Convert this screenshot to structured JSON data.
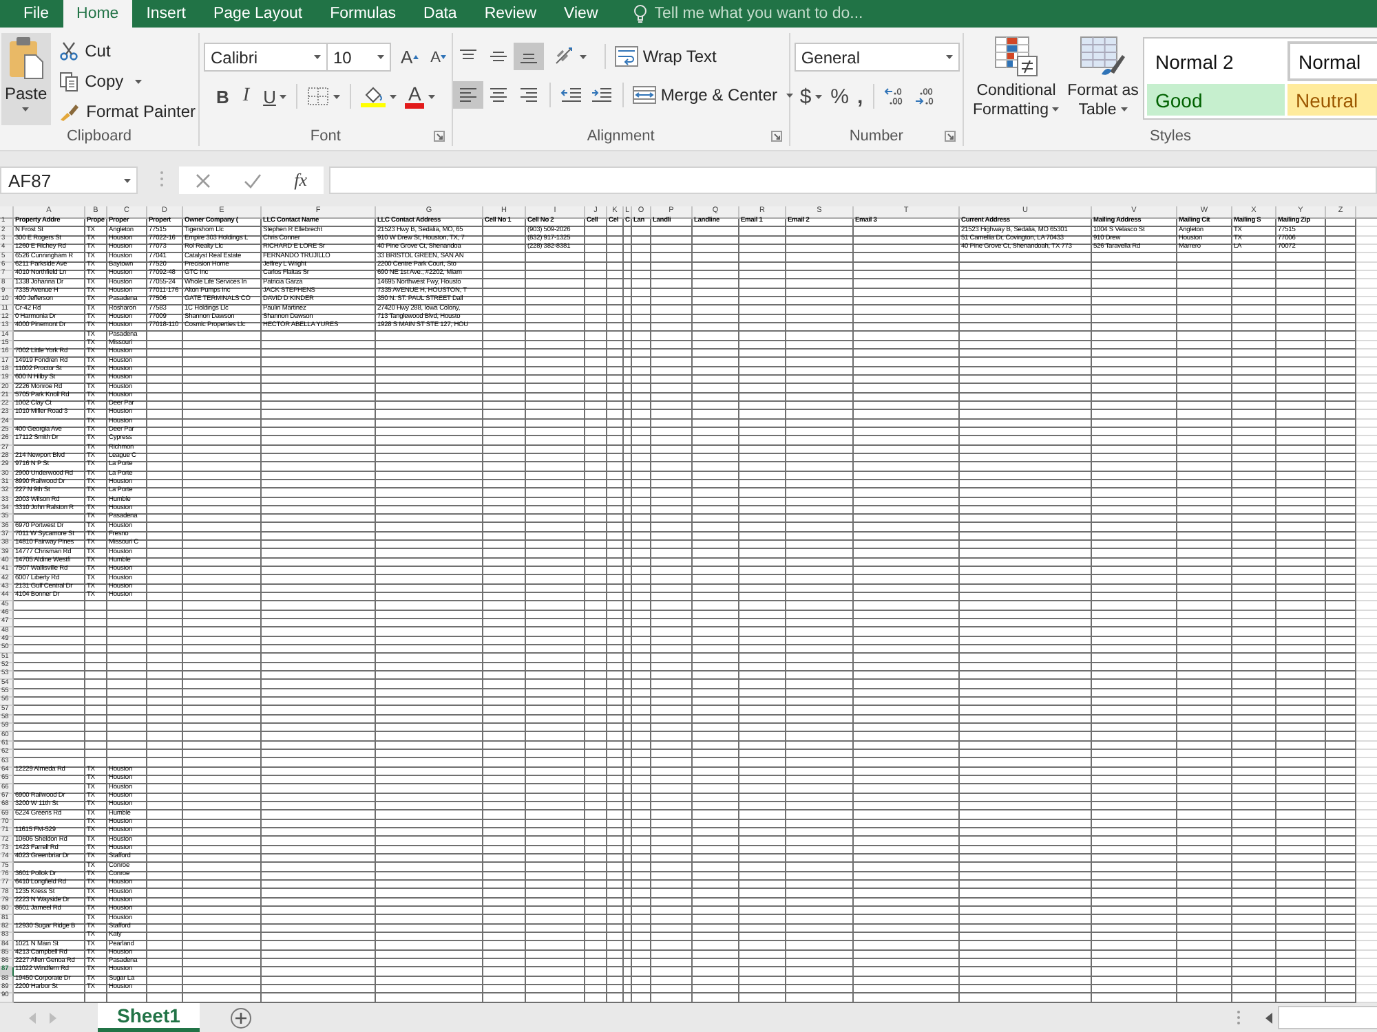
{
  "ribbon_tabs": [
    {
      "label": "File",
      "selected": false
    },
    {
      "label": "Home",
      "selected": true
    },
    {
      "label": "Insert",
      "selected": false
    },
    {
      "label": "Page Layout",
      "selected": false
    },
    {
      "label": "Formulas",
      "selected": false
    },
    {
      "label": "Data",
      "selected": false
    },
    {
      "label": "Review",
      "selected": false
    },
    {
      "label": "View",
      "selected": false
    }
  ],
  "tell_me": {
    "placeholder": "Tell me what you want to do..."
  },
  "clipboard": {
    "label": "Clipboard",
    "paste": "Paste",
    "cut": "Cut",
    "copy": "Copy",
    "format_painter": "Format Painter"
  },
  "font": {
    "label": "Font",
    "name": "Calibri",
    "size": "10",
    "grow": "A",
    "shrink": "A",
    "bold": "B",
    "italic": "I",
    "underline": "U",
    "font_color": "A"
  },
  "alignment": {
    "label": "Alignment",
    "vertical": [
      {
        "selected": false
      },
      {
        "selected": false
      },
      {
        "selected": true
      }
    ],
    "horizontal": [
      {
        "selected": true
      },
      {
        "selected": false
      },
      {
        "selected": false
      }
    ],
    "wrap_text": "Wrap Text",
    "merge_center": "Merge & Center"
  },
  "number": {
    "label": "Number",
    "format": "General",
    "currency": "$",
    "percent": "%",
    "comma": ","
  },
  "styles": {
    "label": "Styles",
    "conditional_formatting": "Conditional Formatting",
    "format_as_table": "Format as Table",
    "gallery": [
      {
        "label": "Normal 2",
        "kind": "plain"
      },
      {
        "label": "Normal",
        "kind": "normal"
      },
      {
        "label": "Good",
        "kind": "good"
      },
      {
        "label": "Neutral",
        "kind": "neutral"
      }
    ]
  },
  "formula_bar": {
    "name_box": "AF87",
    "function_label": "fx"
  },
  "sheet": {
    "columns": [
      "A",
      "B",
      "C",
      "D",
      "E",
      "F",
      "G",
      "H",
      "I",
      "J",
      "K",
      "L",
      "O",
      "P",
      "Q",
      "R",
      "S",
      "T",
      "U",
      "V",
      "W",
      "X",
      "Y",
      "Z"
    ],
    "rows": [
      {
        "number": "1",
        "selected": false,
        "cells": [
          "Property Addre",
          "Prope",
          "Proper",
          "Propert",
          "Owner Company (",
          "LLC Contact Name",
          "LLC Contact Address",
          "Cell No 1",
          "Cell No 2",
          "Cell",
          "Cel",
          "C",
          "Lan",
          "Landli",
          "Landline",
          "Email 1",
          "Email 2",
          "Email 3",
          "Current Address",
          "Mailing Address",
          "Mailing Cit",
          "Mailing S",
          "Mailing Zip",
          null
        ]
      },
      {
        "number": "2",
        "selected": false,
        "cells": [
          "N Frost St",
          "TX",
          "Angleton",
          "77515",
          "Tigershom Llc",
          "Stephen R Ellebrecht",
          "21523 Hwy B, Sedalia, MO, 65",
          null,
          "(903) 509-2026",
          null,
          null,
          null,
          null,
          null,
          null,
          null,
          null,
          null,
          "21523 Highway B, Sedalia, MO 65301",
          "1004 S Velasco St",
          "Angleton",
          "TX",
          "77515",
          null
        ]
      },
      {
        "number": "3",
        "selected": false,
        "cells": [
          "300 E Rogers St",
          "TX",
          "Houston",
          "77022-16",
          "Empire 303 Holdings L",
          "Chris Conner",
          "910 W Drew St, Houston, TX, 7",
          null,
          "(832) 917-1325",
          null,
          null,
          null,
          null,
          null,
          null,
          null,
          null,
          null,
          "51 Camellia Dr, Covington, LA 70433",
          "910 Drew",
          "Houston",
          "TX",
          "77006",
          null
        ]
      },
      {
        "number": "4",
        "selected": false,
        "cells": [
          "1260 E Richey Rd",
          "TX",
          "Houston",
          "77073",
          "Rol Realty Llc",
          "RICHARD E LORE Sr",
          "40 Pine Grove Ct, Shenandoa",
          null,
          "(228) 382-8381",
          null,
          null,
          null,
          null,
          null,
          null,
          null,
          null,
          null,
          "40 Pine Grove Ct, Shenandoah, TX 773",
          "526 Taravella Rd",
          "Marrero",
          "LA",
          "70072",
          null
        ]
      },
      {
        "number": "5",
        "selected": false,
        "cells": [
          "6526 Cunningham R",
          "TX",
          "Houston",
          "77041",
          "Catalyst Real Estate",
          "FERNANDO TRUJILLO",
          "33 BRISTOL GREEN, SAN AN"
        ]
      },
      {
        "number": "6",
        "selected": false,
        "cells": [
          "6211 Parkside Ave",
          "TX",
          "Baytown",
          "77520",
          "Precision Home",
          "Jeffrey L Wright",
          "2200 Centre Park Court, Sto"
        ]
      },
      {
        "number": "7",
        "selected": false,
        "cells": [
          "4010 Northfield Ln",
          "TX",
          "Houston",
          "77092-48",
          "GTC Inc",
          "Carlos Flaitas Sr",
          "690 NE 1st Ave., #2202, Miam"
        ]
      },
      {
        "number": "8",
        "selected": false,
        "cells": [
          "1338 Johanna Dr",
          "TX",
          "Houston",
          "77055-24",
          "Whole Life Services In",
          "Patricia Garza",
          "14695 Northwest Fwy, Housto"
        ]
      },
      {
        "number": "9",
        "selected": false,
        "cells": [
          "7335 Avenue H",
          "TX",
          "Houston",
          "77011-176",
          "Alton Pumps Inc",
          "JACK STEPHENS",
          "7335 AVENUE H, HOUSTON, T"
        ]
      },
      {
        "number": "10",
        "selected": false,
        "cells": [
          "400 Jefferson",
          "TX",
          "Pasadena",
          "77506",
          "GATE TERMINALS CO",
          "DAVID D KINDER",
          "350 N. ST. PAUL STREET Dall"
        ]
      },
      {
        "number": "11",
        "selected": false,
        "cells": [
          "Cr-42 Rd",
          "TX",
          "Rosharon",
          "77583",
          "1C Holdings Llc",
          "Paulin Martinez",
          "27420 Hwy 288, Iowa Colony,"
        ]
      },
      {
        "number": "12",
        "selected": false,
        "cells": [
          "0 Harmonia Dr",
          "TX",
          "Houston",
          "77009",
          "Shannon Dawson",
          "Shannon Dawson",
          "713 Tanglewood Blvd, Housto"
        ]
      },
      {
        "number": "13",
        "selected": false,
        "cells": [
          "4000 Pinemont Dr",
          "TX",
          "Houston",
          "77018-110",
          "Cosmic Properties Llc",
          "HECTOR ABELLA YURES",
          "1928 S MAIN ST STE 127, HOU"
        ]
      },
      {
        "number": "14",
        "selected": false,
        "cells": [
          null,
          "TX",
          "Pasadena"
        ]
      },
      {
        "number": "15",
        "selected": false,
        "cells": [
          null,
          "TX",
          "Missouri"
        ]
      },
      {
        "number": "16",
        "selected": false,
        "cells": [
          "7002 Little York Rd",
          "TX",
          "Houston"
        ]
      },
      {
        "number": "17",
        "selected": false,
        "cells": [
          "14919 Fondren Rd",
          "TX",
          "Houston"
        ]
      },
      {
        "number": "18",
        "selected": false,
        "cells": [
          "11002 Proctor St",
          "TX",
          "Houston"
        ]
      },
      {
        "number": "19",
        "selected": false,
        "cells": [
          "600 N Hilby St",
          "TX",
          "Houston"
        ]
      },
      {
        "number": "20",
        "selected": false,
        "cells": [
          "2226 Monroe Rd",
          "TX",
          "Houston"
        ]
      },
      {
        "number": "21",
        "selected": false,
        "cells": [
          "5705 Park Knoll Rd",
          "TX",
          "Houston"
        ]
      },
      {
        "number": "22",
        "selected": false,
        "cells": [
          "1002 Clay Ct",
          "TX",
          "Deer Par"
        ]
      },
      {
        "number": "23",
        "selected": false,
        "cells": [
          "1010 Miller Road 3",
          "TX",
          "Houston"
        ]
      },
      {
        "number": "24",
        "selected": false,
        "cells": [
          null,
          "TX",
          "Houston"
        ]
      },
      {
        "number": "25",
        "selected": false,
        "cells": [
          "400 Georgia Ave",
          "TX",
          "Deer Par"
        ]
      },
      {
        "number": "26",
        "selected": false,
        "cells": [
          "17112 Smith Dr",
          "TX",
          "Cypress"
        ]
      },
      {
        "number": "27",
        "selected": false,
        "cells": [
          null,
          "TX",
          "Richmon"
        ]
      },
      {
        "number": "28",
        "selected": false,
        "cells": [
          "214 Newport Blvd",
          "TX",
          "League C"
        ]
      },
      {
        "number": "29",
        "selected": false,
        "cells": [
          "9716 N P St",
          "TX",
          "La Porte"
        ]
      },
      {
        "number": "30",
        "selected": false,
        "cells": [
          "2900 Underwood Rd",
          "TX",
          "La Porte"
        ]
      },
      {
        "number": "31",
        "selected": false,
        "cells": [
          "8990 Railwood Dr",
          "TX",
          "Houston"
        ]
      },
      {
        "number": "32",
        "selected": false,
        "cells": [
          "227 N 9th St",
          "TX",
          "La Porte"
        ]
      },
      {
        "number": "33",
        "selected": false,
        "cells": [
          "2003 Wilson Rd",
          "TX",
          "Humble"
        ]
      },
      {
        "number": "34",
        "selected": false,
        "cells": [
          "3310 John Ralston R",
          "TX",
          "Houston"
        ]
      },
      {
        "number": "35",
        "selected": false,
        "cells": [
          null,
          "TX",
          "Pasadena"
        ]
      },
      {
        "number": "36",
        "selected": false,
        "cells": [
          "6970 Portwest Dr",
          "TX",
          "Houston"
        ]
      },
      {
        "number": "37",
        "selected": false,
        "cells": [
          "7011 W Sycamore St",
          "TX",
          "Fresno"
        ]
      },
      {
        "number": "38",
        "selected": false,
        "cells": [
          "14810 Fairway Pines",
          "TX",
          "Missouri C"
        ]
      },
      {
        "number": "39",
        "selected": false,
        "cells": [
          "14777 Chrisman Rd",
          "TX",
          "Houston"
        ]
      },
      {
        "number": "40",
        "selected": false,
        "cells": [
          "14705 Aldine Westfi",
          "TX",
          "Humble"
        ]
      },
      {
        "number": "41",
        "selected": false,
        "cells": [
          "7507 Wallisville Rd",
          "TX",
          "Houston"
        ]
      },
      {
        "number": "42",
        "selected": false,
        "cells": [
          "6007 Liberty Rd",
          "TX",
          "Houston"
        ]
      },
      {
        "number": "43",
        "selected": false,
        "cells": [
          "2131 Gulf Central Dr",
          "TX",
          "Houston"
        ]
      },
      {
        "number": "44",
        "selected": false,
        "cells": [
          "4104 Bonner Dr",
          "TX",
          "Houston"
        ]
      },
      {
        "number": "45",
        "selected": false
      },
      {
        "number": "46",
        "selected": false
      },
      {
        "number": "47",
        "selected": false
      },
      {
        "number": "48",
        "selected": false
      },
      {
        "number": "49",
        "selected": false
      },
      {
        "number": "50",
        "selected": false
      },
      {
        "number": "51",
        "selected": false
      },
      {
        "number": "52",
        "selected": false
      },
      {
        "number": "53",
        "selected": false
      },
      {
        "number": "54",
        "selected": false
      },
      {
        "number": "55",
        "selected": false
      },
      {
        "number": "56",
        "selected": false
      },
      {
        "number": "57",
        "selected": false
      },
      {
        "number": "58",
        "selected": false
      },
      {
        "number": "59",
        "selected": false
      },
      {
        "number": "60",
        "selected": false
      },
      {
        "number": "61",
        "selected": false
      },
      {
        "number": "62",
        "selected": false
      },
      {
        "number": "63",
        "selected": false
      },
      {
        "number": "64",
        "selected": false,
        "cells": [
          "12229 Almeda Rd",
          "TX",
          "Houston"
        ]
      },
      {
        "number": "65",
        "selected": false,
        "cells": [
          null,
          "TX",
          "Houston"
        ]
      },
      {
        "number": "66",
        "selected": false,
        "cells": [
          null,
          "TX",
          "Houston"
        ]
      },
      {
        "number": "67",
        "selected": false,
        "cells": [
          "6900 Railwood Dr",
          "TX",
          "Houston"
        ]
      },
      {
        "number": "68",
        "selected": false,
        "cells": [
          "3200 W 11th St",
          "TX",
          "Houston"
        ]
      },
      {
        "number": "69",
        "selected": false,
        "cells": [
          "6224 Greens Rd",
          "TX",
          "Humble"
        ]
      },
      {
        "number": "70",
        "selected": false,
        "cells": [
          null,
          "TX",
          "Houston"
        ]
      },
      {
        "number": "71",
        "selected": false,
        "cells": [
          "11615 FM-529",
          "TX",
          "Houston"
        ]
      },
      {
        "number": "72",
        "selected": false,
        "cells": [
          "10606 Sheldon Rd",
          "TX",
          "Houston"
        ]
      },
      {
        "number": "73",
        "selected": false,
        "cells": [
          "1423 Farrell Rd",
          "TX",
          "Houston"
        ]
      },
      {
        "number": "74",
        "selected": false,
        "cells": [
          "4023 Greenbriar Dr",
          "TX",
          "Stafford"
        ]
      },
      {
        "number": "75",
        "selected": false,
        "cells": [
          null,
          "TX",
          "Conroe"
        ]
      },
      {
        "number": "76",
        "selected": false,
        "cells": [
          "3601 Pollok Dr",
          "TX",
          "Conroe"
        ]
      },
      {
        "number": "77",
        "selected": false,
        "cells": [
          "6410 Longfield Rd",
          "TX",
          "Houston"
        ]
      },
      {
        "number": "78",
        "selected": false,
        "cells": [
          "1235 Kress St",
          "TX",
          "Houston"
        ]
      },
      {
        "number": "79",
        "selected": false,
        "cells": [
          "2223 N Wayside Dr",
          "TX",
          "Houston"
        ]
      },
      {
        "number": "80",
        "selected": false,
        "cells": [
          "8601 Jameel Rd",
          "TX",
          "Houston"
        ]
      },
      {
        "number": "81",
        "selected": false,
        "cells": [
          null,
          "TX",
          "Houston"
        ]
      },
      {
        "number": "82",
        "selected": false,
        "cells": [
          "12930 Sugar Ridge B",
          "TX",
          "Stafford"
        ]
      },
      {
        "number": "83",
        "selected": false,
        "cells": [
          null,
          "TX",
          "Katy"
        ]
      },
      {
        "number": "84",
        "selected": false,
        "cells": [
          "1021 N Main St",
          "TX",
          "Pearland"
        ]
      },
      {
        "number": "85",
        "selected": false,
        "cells": [
          "4213 Campbell Rd",
          "TX",
          "Houston"
        ]
      },
      {
        "number": "86",
        "selected": false,
        "cells": [
          "2227 Allen Genoa Rd",
          "TX",
          "Pasadena"
        ]
      },
      {
        "number": "87",
        "selected": true,
        "cells": [
          "11022 Windfern Rd",
          "TX",
          "Houston"
        ]
      },
      {
        "number": "88",
        "selected": false,
        "cells": [
          "19450 Corporate Dr",
          "TX",
          "Sugar La"
        ]
      },
      {
        "number": "89",
        "selected": false,
        "cells": [
          "2200 Harbor St",
          "TX",
          "Houston"
        ]
      },
      {
        "number": "90",
        "selected": false
      }
    ]
  },
  "sheet_tabs": [
    {
      "label": "Sheet1",
      "selected": true
    }
  ]
}
